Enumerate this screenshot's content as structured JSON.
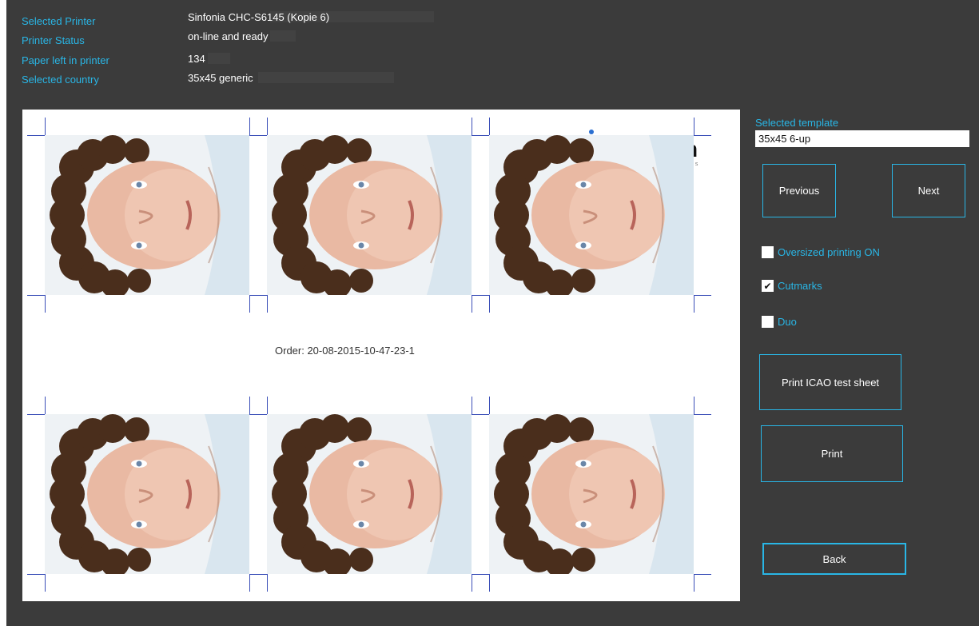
{
  "info": {
    "rows": [
      {
        "label": "Selected Printer",
        "value": "Sinfonia CHC-S6145 (Kopie 6)"
      },
      {
        "label": "Printer Status",
        "value": "on-line and ready"
      },
      {
        "label": "Paper left in printer",
        "value": "134"
      },
      {
        "label": "Selected country",
        "value": "35x45 generic"
      }
    ]
  },
  "preview": {
    "order_text": "Order: 20-08-2015-10-47-23-1",
    "brand_letter": "n",
    "brand_sub": "tos"
  },
  "template": {
    "label": "Selected template",
    "value": "35x45 6-up"
  },
  "buttons": {
    "previous": "Previous",
    "next": "Next",
    "print_icao": "Print ICAO test sheet",
    "print": "Print",
    "back": "Back"
  },
  "options": [
    {
      "label": "Oversized printing ON",
      "checked": false
    },
    {
      "label": "Cutmarks",
      "checked": true
    },
    {
      "label": "Duo",
      "checked": false
    }
  ],
  "colors": {
    "background": "#3b3b3b",
    "accent": "#29b6e6",
    "cutmark": "#3b4fb8"
  }
}
